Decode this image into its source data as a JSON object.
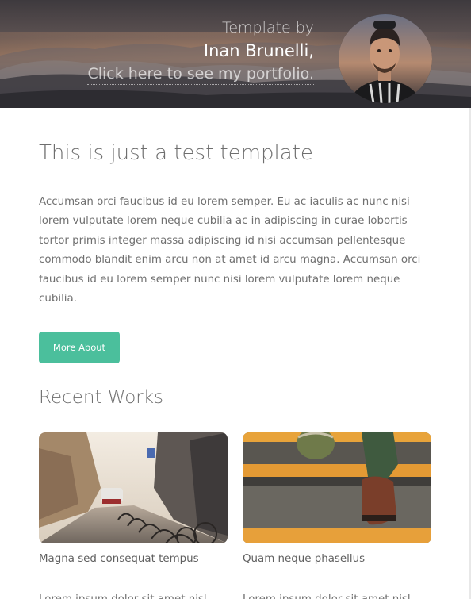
{
  "header": {
    "tagline": "Template by",
    "author": "Inan Brunelli,",
    "portfolio_link": "Click here to see my portfolio."
  },
  "main": {
    "title": "This is just a test template",
    "body": "Accumsan orci faucibus id eu lorem semper. Eu ac iaculis ac nunc nisi lorem vulputate lorem neque cubilia ac in adipiscing in curae lobortis tortor primis integer massa adipiscing id nisi accumsan pellentesque commodo blandit enim arcu non at amet id arcu magna. Accumsan orci faucibus id eu lorem semper nunc nisi lorem vulputate lorem neque cubilia.",
    "button_label": "More About"
  },
  "recent_works": {
    "title": "Recent Works",
    "items": [
      {
        "caption": "Magna sed consequat tempus",
        "excerpt": "Lorem ipsum dolor sit amet nisl"
      },
      {
        "caption": "Quam neque phasellus",
        "excerpt": "Lorem ipsum dolor sit amet nisl"
      }
    ]
  },
  "colors": {
    "accent": "#4bbf9c",
    "heading": "#6e6e6e",
    "text": "#707070"
  }
}
